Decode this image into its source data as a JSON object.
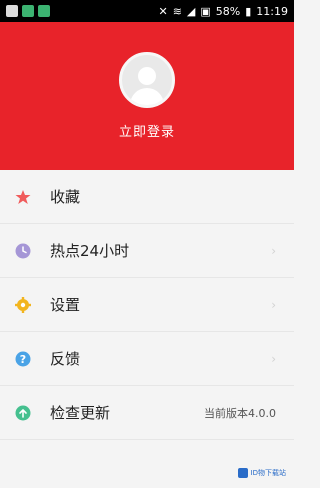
{
  "status_bar": {
    "battery_percent": "58%",
    "time": "11:19",
    "icons": [
      "image-notification-icon",
      "download-notification-icon",
      "download-notification-icon",
      "mute-icon",
      "wifi-icon",
      "signal-icon",
      "sim-icon",
      "battery-icon"
    ]
  },
  "header": {
    "background_color": "#e8232a",
    "login_label": "立即登录"
  },
  "menu": {
    "items": [
      {
        "label": "收藏",
        "icon": "star-icon",
        "icon_color": "#f05b5b"
      },
      {
        "label": "热点24小时",
        "icon": "clock-icon",
        "icon_color": "#a596d6"
      },
      {
        "label": "设置",
        "icon": "gear-icon",
        "icon_color": "#f2b51f"
      },
      {
        "label": "反馈",
        "icon": "help-icon",
        "icon_color": "#4aa3e6"
      },
      {
        "label": "检查更新",
        "icon": "upload-icon",
        "icon_color": "#45c08f",
        "value": "当前版本4.0.0"
      }
    ]
  },
  "watermark": "ID物下载站"
}
